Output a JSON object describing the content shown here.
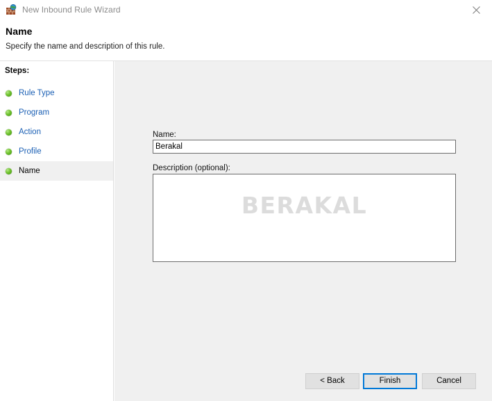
{
  "window": {
    "title": "New Inbound Rule Wizard",
    "title_icon": "firewall-brick-wall-globe-icon",
    "close_icon": "close-icon"
  },
  "header": {
    "title": "Name",
    "subtitle": "Specify the name and description of this rule."
  },
  "sidebar": {
    "heading": "Steps:",
    "items": [
      {
        "label": "Rule Type",
        "current": false
      },
      {
        "label": "Program",
        "current": false
      },
      {
        "label": "Action",
        "current": false
      },
      {
        "label": "Profile",
        "current": false
      },
      {
        "label": "Name",
        "current": true
      }
    ]
  },
  "form": {
    "name_label": "Name:",
    "name_value": "Berakal",
    "name_placeholder": "",
    "description_label": "Description (optional):",
    "description_value": "",
    "description_placeholder": "",
    "watermark": "BERAKAL"
  },
  "buttons": {
    "back": "< Back",
    "finish": "Finish",
    "cancel": "Cancel"
  },
  "colors": {
    "accent": "#0078d7",
    "link": "#1a5fb4",
    "panel": "#f0f0f0",
    "bullet_green": "#6fc22c",
    "watermark": "#dcdcdc"
  }
}
